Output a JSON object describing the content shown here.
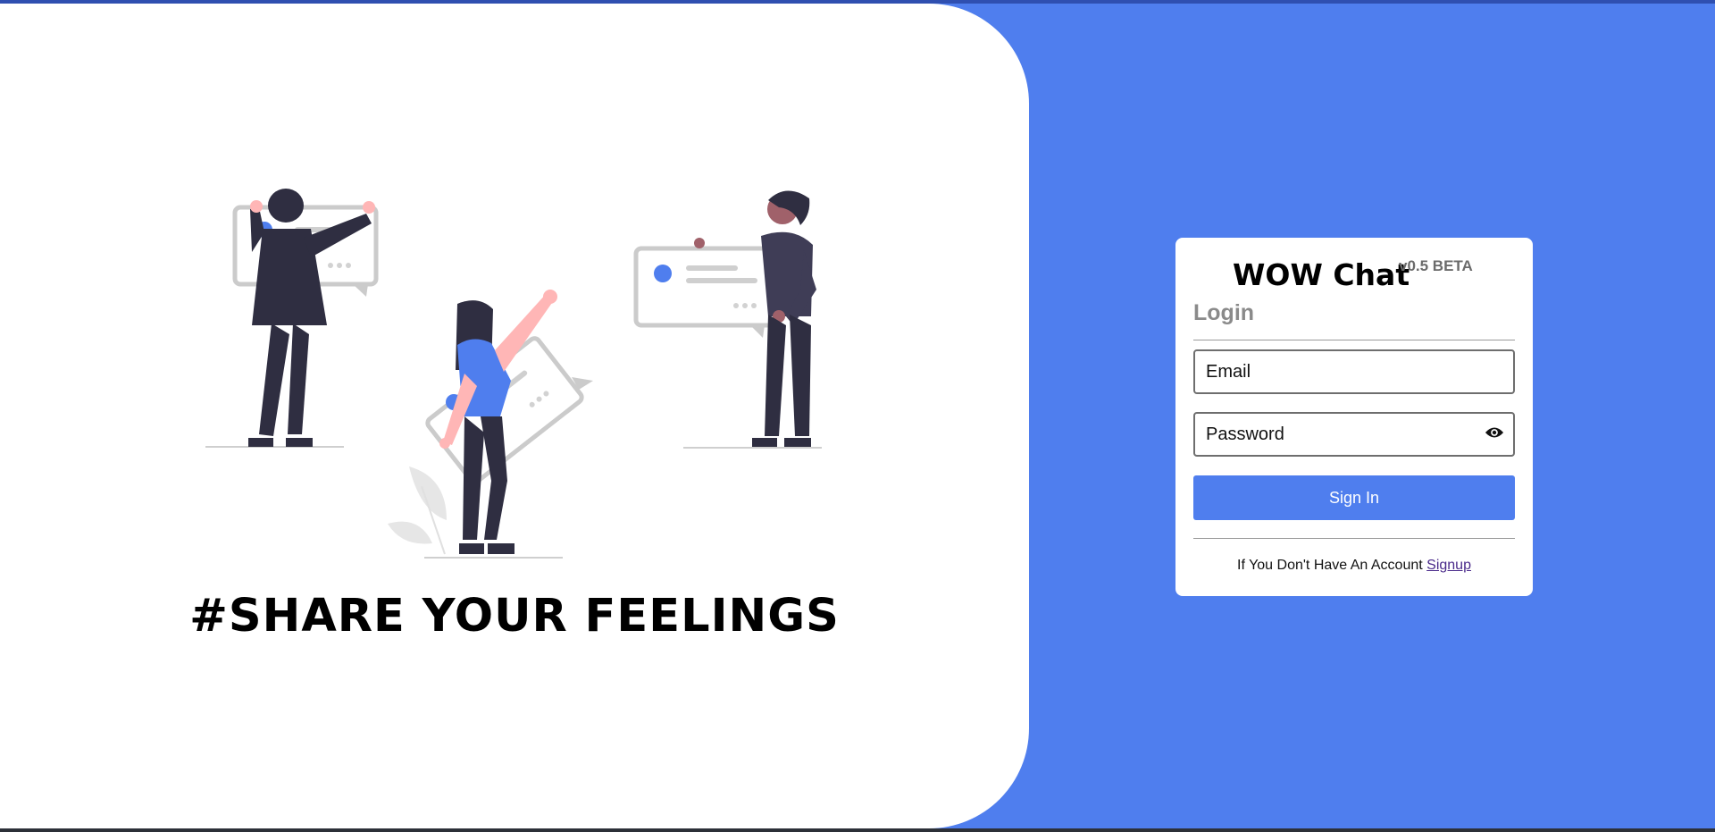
{
  "colors": {
    "accent": "#4f7eee",
    "card_background": "#ffffff",
    "link": "#4a2a8a"
  },
  "hero": {
    "tagline": "#SHARE YOUR FEELINGS",
    "illustration": "people-with-chat-bubbles-illustration"
  },
  "login_card": {
    "brand_title": "WOW Chat",
    "version": "v0.5 BETA",
    "heading": "Login",
    "email_placeholder": "Email",
    "email_value": "",
    "password_placeholder": "Password",
    "password_value": "",
    "password_toggle_icon": "eye-icon",
    "sign_in_label": "Sign In",
    "signup_prompt": "If You Don't Have An Account",
    "signup_link": "Signup"
  }
}
